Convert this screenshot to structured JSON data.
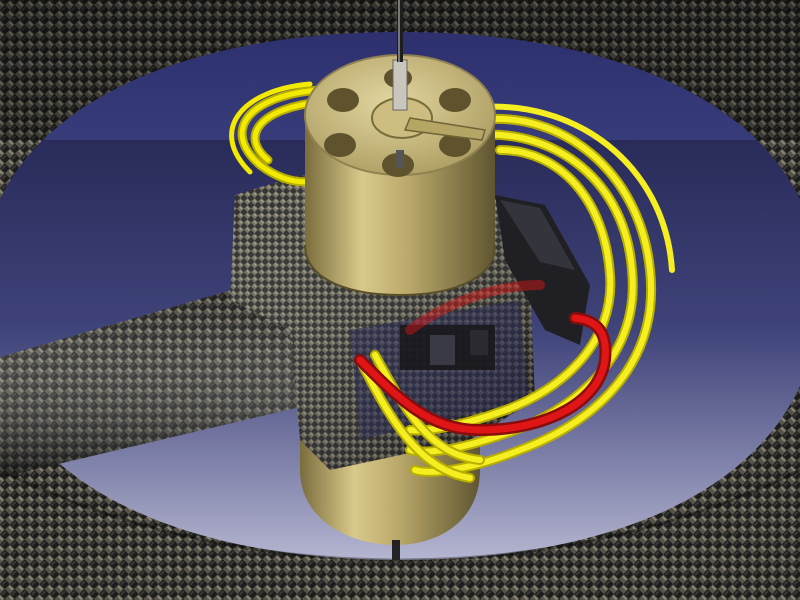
{
  "scene": {
    "colors": {
      "background_top": "#2e3270",
      "background_bottom": "#c9c9dd",
      "carbon_dark": "#1c1c1c",
      "carbon_light": "#9a9680",
      "brass": "#c8b87a",
      "brass_dark": "#6f6436",
      "cable_yellow": "#f2ea00",
      "cable_red": "#e01515",
      "electronics_dark": "#202024"
    },
    "objects": [
      "carbon-fiber-ring-duct",
      "carbon-fiber-arm-tube",
      "carbon-fiber-motor-mount",
      "brushless-motor",
      "yellow-cable-bundle",
      "red-cable",
      "electronic-speed-controller",
      "shaft"
    ]
  }
}
